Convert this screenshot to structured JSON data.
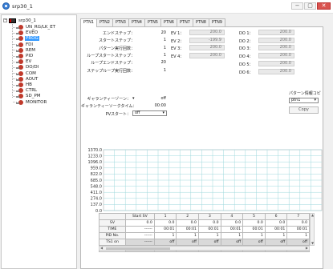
{
  "window": {
    "title": "srp30_1",
    "min": "−",
    "max": "▢",
    "close": "✕"
  },
  "tree": {
    "root": "srp30_1",
    "items": [
      "UN_RG/LK_ET",
      "EVEO",
      "PROG",
      "FDI",
      "REM",
      "PID",
      "EV",
      "DO/DI",
      "COM",
      "AOUT",
      "HB",
      "CTRL",
      "SD_PM",
      "MONITOR"
    ],
    "selected_index": 2
  },
  "tabs": [
    "PTN1",
    "PTN2",
    "PTN3",
    "PTN4",
    "PTN5",
    "PTN6",
    "PTN7",
    "PTN8",
    "PTN9"
  ],
  "form": {
    "rows": [
      {
        "label": "エンドステップ：",
        "value": "20"
      },
      {
        "label": "スタートステップ：",
        "value": "1"
      },
      {
        "label": "パターン実行回数：",
        "value": "1"
      },
      {
        "label": "ループスタートステップ：",
        "value": "1"
      },
      {
        "label": "ループエンドステップ：",
        "value": "20"
      },
      {
        "label": "ステップループ実行回数：",
        "value": "1"
      }
    ],
    "guarantee_zone": {
      "label": "ギャランティーゾーン：",
      "value": "off"
    },
    "guarantee_time": {
      "label": "ギャランティーソークタイム：",
      "value": "00:00"
    },
    "pv_start": {
      "label": "PVスタート：",
      "value": "off"
    }
  },
  "ev": [
    {
      "label": "EV 1：",
      "value": "200.0"
    },
    {
      "label": "EV 2：",
      "value": "-199.9"
    },
    {
      "label": "EV 3：",
      "value": "200.0"
    },
    {
      "label": "EV 4：",
      "value": "200.0"
    }
  ],
  "do": [
    {
      "label": "DO 1：",
      "value": "200.0"
    },
    {
      "label": "DO 2：",
      "value": "200.0"
    },
    {
      "label": "DO 3：",
      "value": "200.0"
    },
    {
      "label": "DO 4：",
      "value": "200.0"
    },
    {
      "label": "DO 5：",
      "value": "200.0"
    },
    {
      "label": "DO 6：",
      "value": "200.0"
    }
  ],
  "pattern_copy": {
    "label": "パターン情報コピー",
    "select": "ptn1",
    "button": "Copy"
  },
  "chart_data": {
    "type": "line",
    "ylim": [
      0.0,
      1370.0
    ],
    "yticks": [
      "1370.0",
      "1233.0",
      "1096.0",
      "959.0",
      "822.0",
      "685.0",
      "548.0",
      "411.0",
      "274.0",
      "137.0",
      "0.0"
    ],
    "series": []
  },
  "table": {
    "headers": [
      "",
      "Start SV",
      "1",
      "2",
      "3",
      "4",
      "5",
      "6",
      "7"
    ],
    "rows": [
      {
        "name": "SV",
        "cells": [
          "0.0",
          "0.0",
          "0.0",
          "0.0",
          "0.0",
          "0.0",
          "0.0",
          "0.0"
        ]
      },
      {
        "name": "TIME",
        "cells": [
          "------",
          "00:01",
          "00:01",
          "00:01",
          "00:01",
          "00:01",
          "00:01",
          "00:01"
        ]
      },
      {
        "name": "PID No.",
        "cells": [
          "------",
          "1",
          "1",
          "1",
          "1",
          "1",
          "1",
          "1"
        ]
      },
      {
        "name": "TS1 on",
        "cells": [
          "------",
          "off",
          "off",
          "off",
          "off",
          "off",
          "off",
          "off"
        ]
      },
      {
        "name": "TS1 off",
        "cells": [
          "------",
          "off",
          "off",
          "off",
          "off",
          "off",
          "off",
          "off"
        ]
      }
    ]
  }
}
